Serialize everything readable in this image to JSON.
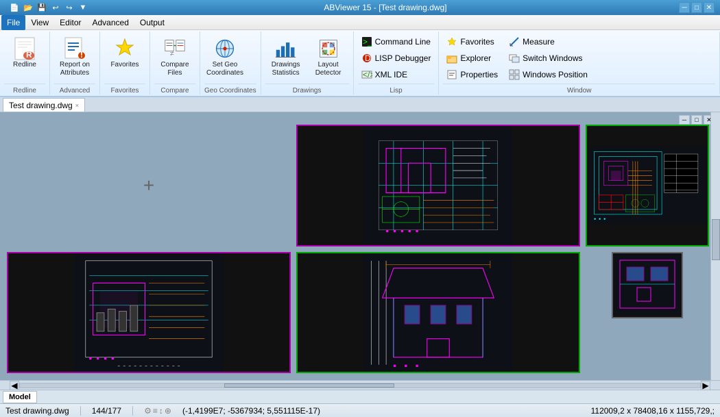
{
  "titlebar": {
    "title": "ABViewer 15 - [Test drawing.dwg]",
    "controls": [
      "minimize",
      "maximize",
      "close"
    ]
  },
  "quickaccess": {
    "buttons": [
      "new",
      "open",
      "save",
      "undo",
      "redo",
      "customize"
    ]
  },
  "menubar": {
    "items": [
      "File",
      "View",
      "Editor",
      "Advanced",
      "Output"
    ]
  },
  "ribbon": {
    "groups": [
      {
        "name": "Redline",
        "label": "Redline",
        "items": [
          "Redline"
        ]
      },
      {
        "name": "Advanced",
        "label": "Advanced",
        "items": [
          "Report on Attributes"
        ]
      },
      {
        "name": "Favorites",
        "label": "Favorites",
        "items": [
          "Favorites"
        ]
      },
      {
        "name": "Compare",
        "label": "Compare",
        "items": [
          "Compare Files"
        ]
      },
      {
        "name": "Geo Coordinates",
        "label": "Geo Coordinates",
        "items": [
          "Set Geo Coordinates"
        ]
      },
      {
        "name": "Drawings",
        "label": "Drawings",
        "items": [
          "Drawings Statistics",
          "Layout Detector"
        ]
      },
      {
        "name": "Lisp",
        "label": "Lisp",
        "items": [
          "Command Line",
          "LISP Debugger",
          "XML IDE"
        ]
      },
      {
        "name": "Window",
        "label": "Window",
        "items": [
          "Measure",
          "Switch Windows",
          "Windows Position",
          "Favorites",
          "Explorer",
          "Properties"
        ]
      }
    ],
    "buttons": {
      "redline": "Redline",
      "report_on_attributes": "Report on Attributes",
      "favorites": "Favorites",
      "compare_files": "Compare Files",
      "set_geo_coordinates": "Set Geo Coordinates",
      "drawings_statistics": "Drawings Statistics",
      "layout_detector": "Layout Detector",
      "command_line": "Command Line",
      "lisp_debugger": "LISP Debugger",
      "xml_ide": "XML IDE",
      "measure": "Measure",
      "switch_windows": "Switch Windows",
      "windows_position": "Windows Position",
      "favorites2": "Favorites",
      "explorer": "Explorer",
      "properties": "Properties"
    }
  },
  "document": {
    "tab_label": "Test drawing.dwg",
    "tab_close": "×"
  },
  "statusbar": {
    "filename": "Test drawing.dwg",
    "page_info": "144/177",
    "coordinates": "(-1,4199E7; -5367934; 5,551115E-17)",
    "dimensions": "112009,2 x 78408,16 x 1155,729,;"
  },
  "page_tabs": {
    "active": "Model",
    "items": [
      "Model"
    ]
  }
}
